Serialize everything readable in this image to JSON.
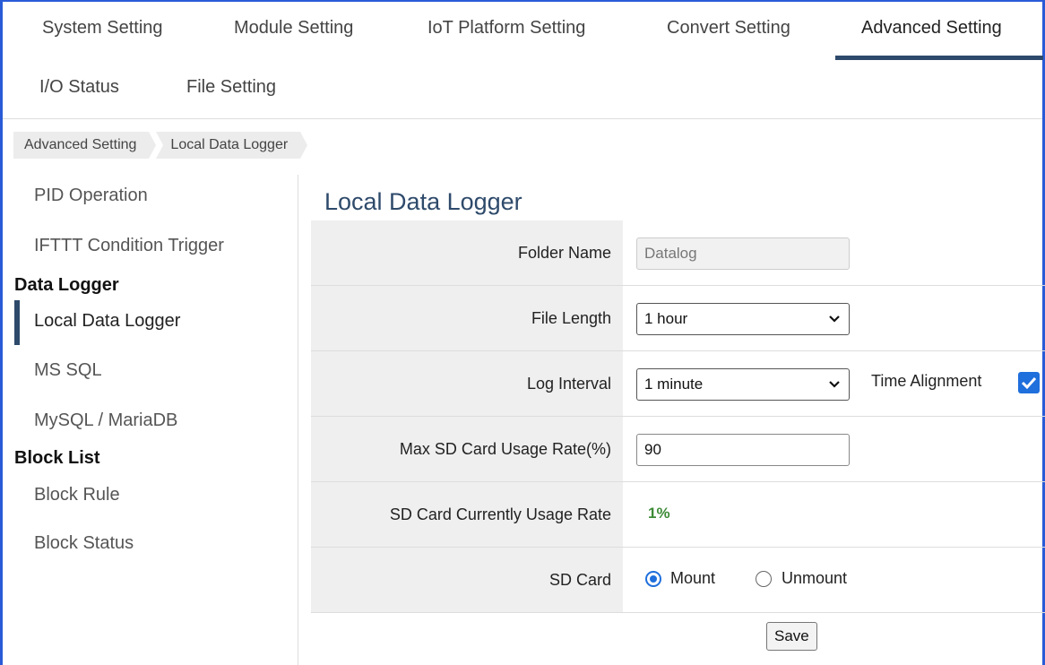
{
  "tabs": {
    "system": "System Setting",
    "module": "Module Setting",
    "iot": "IoT Platform Setting",
    "convert": "Convert Setting",
    "advanced": "Advanced Setting",
    "io_status": "I/O Status",
    "file": "File Setting"
  },
  "breadcrumb": {
    "items": [
      "Advanced Setting",
      "Local Data Logger"
    ]
  },
  "sidebar": {
    "pid": "PID Operation",
    "ifttt": "IFTTT Condition Trigger",
    "data_logger_head": "Data Logger",
    "local": "Local Data Logger",
    "mssql": "MS SQL",
    "mysql": "MySQL / MariaDB",
    "block_list_head": "Block List",
    "block_rule": "Block Rule",
    "block_status": "Block Status"
  },
  "main": {
    "title": "Local Data Logger",
    "folder_label": "Folder Name",
    "folder_value": "Datalog",
    "file_length_label": "File Length",
    "file_length_value": "1 hour",
    "log_interval_label": "Log Interval",
    "log_interval_value": "1 minute",
    "time_alignment_label": "Time Alignment",
    "time_alignment_checked": true,
    "max_usage_label": "Max SD Card Usage Rate(%)",
    "max_usage_value": "90",
    "current_usage_label": "SD Card Currently Usage Rate",
    "current_usage_value": "1%",
    "sd_card_label": "SD Card",
    "mount_label": "Mount",
    "unmount_label": "Unmount",
    "selected_mount": "Mount",
    "save_label": "Save"
  },
  "colors": {
    "accent": "#2e4a6b",
    "checkbox": "#1f6fdc",
    "usage_text": "#3d8b37",
    "frame": "#2a5bd7"
  }
}
